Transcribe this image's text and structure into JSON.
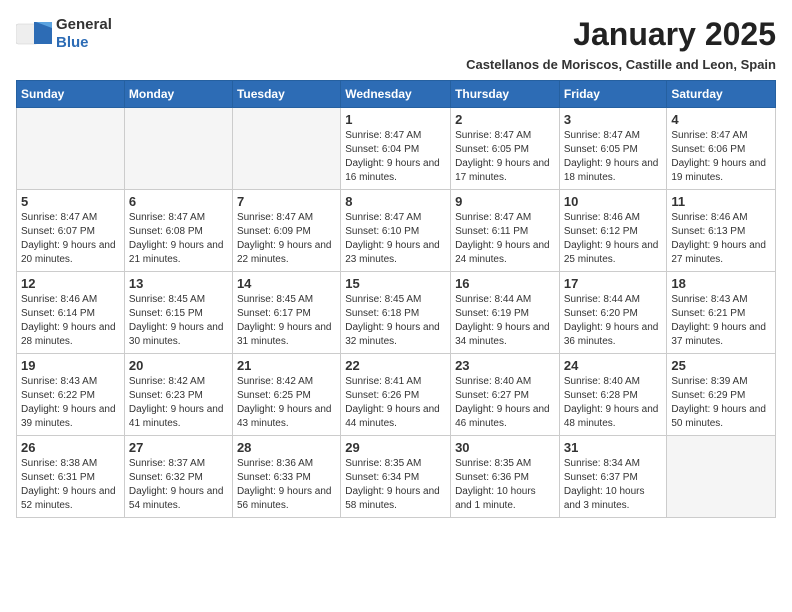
{
  "logo": {
    "general": "General",
    "blue": "Blue"
  },
  "title": "January 2025",
  "subtitle": "Castellanos de Moriscos, Castille and Leon, Spain",
  "days": [
    "Sunday",
    "Monday",
    "Tuesday",
    "Wednesday",
    "Thursday",
    "Friday",
    "Saturday"
  ],
  "weeks": [
    [
      {
        "day": "",
        "content": ""
      },
      {
        "day": "",
        "content": ""
      },
      {
        "day": "",
        "content": ""
      },
      {
        "day": "1",
        "content": "Sunrise: 8:47 AM\nSunset: 6:04 PM\nDaylight: 9 hours and 16 minutes."
      },
      {
        "day": "2",
        "content": "Sunrise: 8:47 AM\nSunset: 6:05 PM\nDaylight: 9 hours and 17 minutes."
      },
      {
        "day": "3",
        "content": "Sunrise: 8:47 AM\nSunset: 6:05 PM\nDaylight: 9 hours and 18 minutes."
      },
      {
        "day": "4",
        "content": "Sunrise: 8:47 AM\nSunset: 6:06 PM\nDaylight: 9 hours and 19 minutes."
      }
    ],
    [
      {
        "day": "5",
        "content": "Sunrise: 8:47 AM\nSunset: 6:07 PM\nDaylight: 9 hours and 20 minutes."
      },
      {
        "day": "6",
        "content": "Sunrise: 8:47 AM\nSunset: 6:08 PM\nDaylight: 9 hours and 21 minutes."
      },
      {
        "day": "7",
        "content": "Sunrise: 8:47 AM\nSunset: 6:09 PM\nDaylight: 9 hours and 22 minutes."
      },
      {
        "day": "8",
        "content": "Sunrise: 8:47 AM\nSunset: 6:10 PM\nDaylight: 9 hours and 23 minutes."
      },
      {
        "day": "9",
        "content": "Sunrise: 8:47 AM\nSunset: 6:11 PM\nDaylight: 9 hours and 24 minutes."
      },
      {
        "day": "10",
        "content": "Sunrise: 8:46 AM\nSunset: 6:12 PM\nDaylight: 9 hours and 25 minutes."
      },
      {
        "day": "11",
        "content": "Sunrise: 8:46 AM\nSunset: 6:13 PM\nDaylight: 9 hours and 27 minutes."
      }
    ],
    [
      {
        "day": "12",
        "content": "Sunrise: 8:46 AM\nSunset: 6:14 PM\nDaylight: 9 hours and 28 minutes."
      },
      {
        "day": "13",
        "content": "Sunrise: 8:45 AM\nSunset: 6:15 PM\nDaylight: 9 hours and 30 minutes."
      },
      {
        "day": "14",
        "content": "Sunrise: 8:45 AM\nSunset: 6:17 PM\nDaylight: 9 hours and 31 minutes."
      },
      {
        "day": "15",
        "content": "Sunrise: 8:45 AM\nSunset: 6:18 PM\nDaylight: 9 hours and 32 minutes."
      },
      {
        "day": "16",
        "content": "Sunrise: 8:44 AM\nSunset: 6:19 PM\nDaylight: 9 hours and 34 minutes."
      },
      {
        "day": "17",
        "content": "Sunrise: 8:44 AM\nSunset: 6:20 PM\nDaylight: 9 hours and 36 minutes."
      },
      {
        "day": "18",
        "content": "Sunrise: 8:43 AM\nSunset: 6:21 PM\nDaylight: 9 hours and 37 minutes."
      }
    ],
    [
      {
        "day": "19",
        "content": "Sunrise: 8:43 AM\nSunset: 6:22 PM\nDaylight: 9 hours and 39 minutes."
      },
      {
        "day": "20",
        "content": "Sunrise: 8:42 AM\nSunset: 6:23 PM\nDaylight: 9 hours and 41 minutes."
      },
      {
        "day": "21",
        "content": "Sunrise: 8:42 AM\nSunset: 6:25 PM\nDaylight: 9 hours and 43 minutes."
      },
      {
        "day": "22",
        "content": "Sunrise: 8:41 AM\nSunset: 6:26 PM\nDaylight: 9 hours and 44 minutes."
      },
      {
        "day": "23",
        "content": "Sunrise: 8:40 AM\nSunset: 6:27 PM\nDaylight: 9 hours and 46 minutes."
      },
      {
        "day": "24",
        "content": "Sunrise: 8:40 AM\nSunset: 6:28 PM\nDaylight: 9 hours and 48 minutes."
      },
      {
        "day": "25",
        "content": "Sunrise: 8:39 AM\nSunset: 6:29 PM\nDaylight: 9 hours and 50 minutes."
      }
    ],
    [
      {
        "day": "26",
        "content": "Sunrise: 8:38 AM\nSunset: 6:31 PM\nDaylight: 9 hours and 52 minutes."
      },
      {
        "day": "27",
        "content": "Sunrise: 8:37 AM\nSunset: 6:32 PM\nDaylight: 9 hours and 54 minutes."
      },
      {
        "day": "28",
        "content": "Sunrise: 8:36 AM\nSunset: 6:33 PM\nDaylight: 9 hours and 56 minutes."
      },
      {
        "day": "29",
        "content": "Sunrise: 8:35 AM\nSunset: 6:34 PM\nDaylight: 9 hours and 58 minutes."
      },
      {
        "day": "30",
        "content": "Sunrise: 8:35 AM\nSunset: 6:36 PM\nDaylight: 10 hours and 1 minute."
      },
      {
        "day": "31",
        "content": "Sunrise: 8:34 AM\nSunset: 6:37 PM\nDaylight: 10 hours and 3 minutes."
      },
      {
        "day": "",
        "content": ""
      }
    ]
  ]
}
